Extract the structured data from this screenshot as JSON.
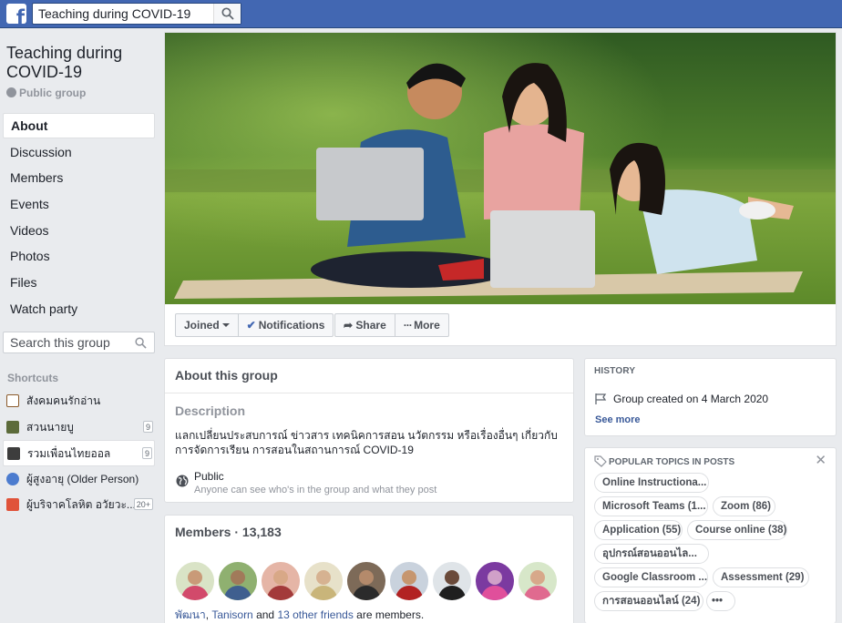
{
  "topbar": {
    "logo": "f",
    "search_value": "Teaching during COVID-19"
  },
  "group": {
    "title": "Teaching during COVID-19",
    "privacy": "Public group"
  },
  "nav": {
    "items": [
      {
        "label": "About"
      },
      {
        "label": "Discussion"
      },
      {
        "label": "Members"
      },
      {
        "label": "Events"
      },
      {
        "label": "Videos"
      },
      {
        "label": "Photos"
      },
      {
        "label": "Files"
      },
      {
        "label": "Watch party"
      }
    ]
  },
  "left_search": {
    "placeholder": "Search this group"
  },
  "shortcuts": {
    "title": "Shortcuts",
    "items": [
      {
        "label": "สังคมคนรักอ่าน",
        "count": "",
        "icon": "book-icon",
        "color": "#8b5a2b"
      },
      {
        "label": "สวนนายบู",
        "count": "9",
        "icon": "garden-icon",
        "color": "#5c6b3a"
      },
      {
        "label": "รวมเพื่อนไทยออล",
        "count": "9",
        "icon": "group-photo-icon",
        "color": "#3d3d3d"
      },
      {
        "label": "ผู้สูงอายุ (Older Person)",
        "count": "",
        "icon": "people-icon",
        "color": "#4c7ccf"
      },
      {
        "label": "ผู้บริจาคโลหิต อวัยวะ...",
        "count": "20+",
        "icon": "gift-icon",
        "color": "#e0533a"
      }
    ]
  },
  "actions": {
    "joined": "Joined",
    "notifications": "Notifications",
    "share": "Share",
    "more": "More"
  },
  "about": {
    "heading": "About this group",
    "desc_label": "Description",
    "desc_text": "แลกเปลี่ยนประสบการณ์ ข่าวสาร เทคนิคการสอน นวัตกรรม หรือเรื่องอื่นๆ เกี่ยวกับการจัดการเรียน การสอนในสถานการณ์ COVID-19",
    "public_label": "Public",
    "public_sub": "Anyone can see who's in the group and what they post"
  },
  "members": {
    "heading": "Members · 13,183",
    "friend1": "พัฒนา",
    "friend2": "Tanisorn",
    "and": " and ",
    "others": "13 other friends",
    "suffix": " are members.",
    "sep": ", "
  },
  "history": {
    "heading": "HISTORY",
    "created": "Group created on 4 March 2020",
    "see_more": "See more"
  },
  "topics": {
    "heading": "POPULAR TOPICS IN POSTS",
    "close": "✕",
    "chips": [
      "Online Instructiona...",
      "Microsoft Teams (1...",
      "Zoom (86)",
      "Application (55)",
      "Course online (38)",
      "อุปกรณ์สอนออนไล...",
      "Google Classroom ...",
      "Assessment (29)",
      "การสอนออนไลน์ (24)",
      "•••"
    ]
  },
  "colors": {
    "brand": "#4267b2",
    "link": "#385898",
    "background": "#e9ebee"
  }
}
